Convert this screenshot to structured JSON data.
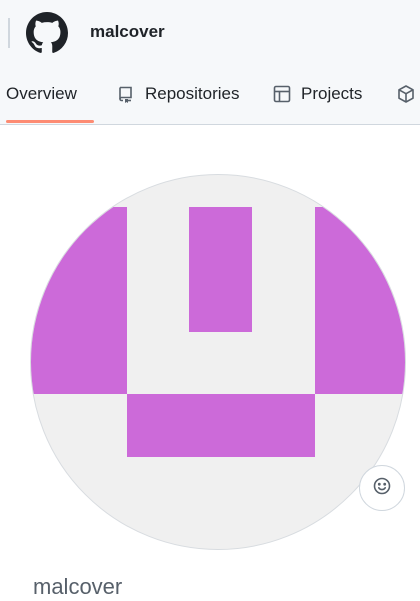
{
  "header": {
    "username": "malcover",
    "logo_icon": "github-logo-icon"
  },
  "tabs": [
    {
      "label": "Overview",
      "icon": "book-icon",
      "active": true
    },
    {
      "label": "Repositories",
      "icon": "repo-icon",
      "active": false
    },
    {
      "label": "Projects",
      "icon": "table-icon",
      "active": false
    },
    {
      "label": "",
      "icon": "package-icon",
      "active": false
    }
  ],
  "profile": {
    "username": "malcover",
    "avatar_color": "#cc6ad9",
    "avatar_background": "#f0f0f0",
    "status_icon": "smiley-icon"
  },
  "colors": {
    "active_tab_underline": "#fd8c73",
    "header_bg": "#f6f8fa"
  }
}
